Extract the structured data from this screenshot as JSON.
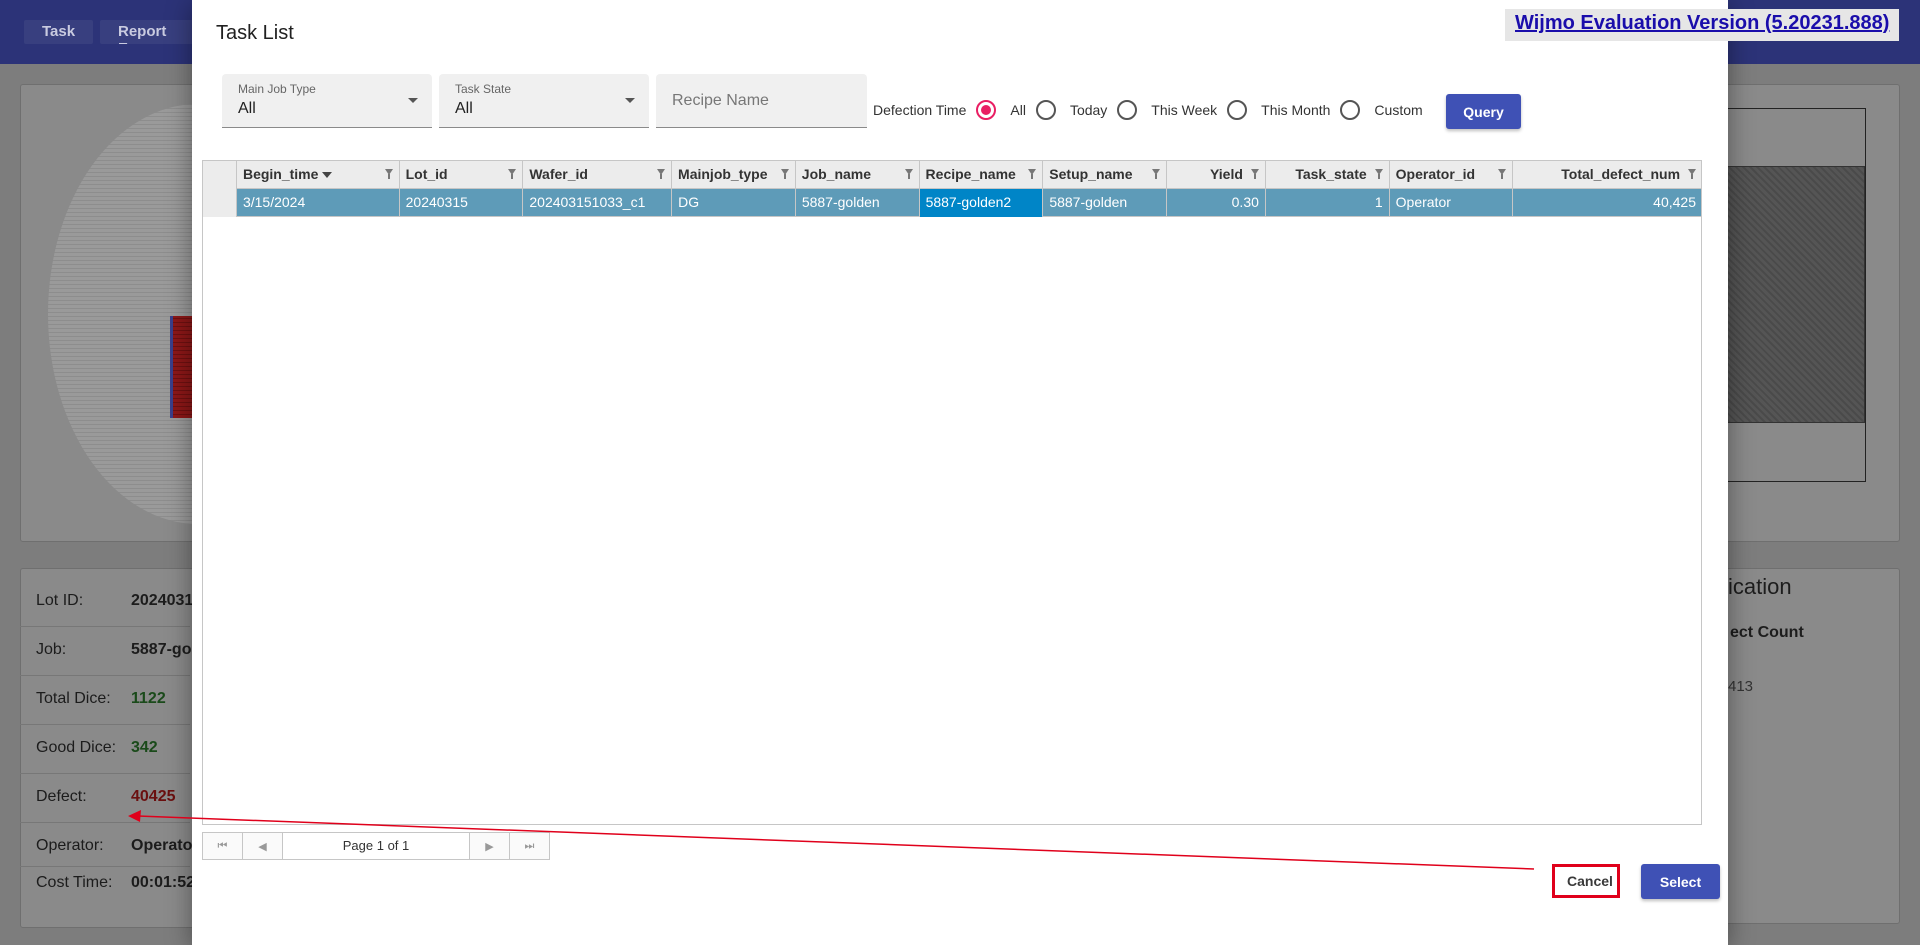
{
  "app": {
    "tabs": [
      {
        "label": "Task"
      },
      {
        "label": "Report Ex"
      }
    ]
  },
  "background_info": {
    "rows": [
      {
        "label": "Lot ID:",
        "value": "2024031"
      },
      {
        "label": "Job:",
        "value": "5887-go"
      },
      {
        "label": "Total Dice:",
        "value": "1122"
      },
      {
        "label": "Good Dice:",
        "value": "342"
      },
      {
        "label": "Defect:",
        "value": "40425"
      },
      {
        "label": "Operator:",
        "value": "Operato"
      },
      {
        "label": "Cost Time:",
        "value": "00:01:52"
      }
    ],
    "right_heading": "ication",
    "right_subheading": "ect Count",
    "right_value": "413"
  },
  "watermark": "Wijmo Evaluation Version (5.20231.888)",
  "dialog": {
    "title": "Task List",
    "filters": {
      "main_job_type": {
        "label": "Main Job Type",
        "value": "All"
      },
      "task_state": {
        "label": "Task State",
        "value": "All"
      },
      "recipe_name": {
        "placeholder": "Recipe Name",
        "value": ""
      },
      "defection_time": {
        "label": "Defection Time",
        "options": [
          {
            "label": "All",
            "checked": true
          },
          {
            "label": "Today",
            "checked": false
          },
          {
            "label": "This Week",
            "checked": false
          },
          {
            "label": "This Month",
            "checked": false
          },
          {
            "label": "Custom",
            "checked": false
          }
        ]
      },
      "query_label": "Query"
    },
    "grid": {
      "columns": [
        {
          "key": "Begin_time",
          "label": "Begin_time",
          "sorted": "desc"
        },
        {
          "key": "Lot_id",
          "label": "Lot_id"
        },
        {
          "key": "Wafer_id",
          "label": "Wafer_id"
        },
        {
          "key": "Mainjob_type",
          "label": "Mainjob_type"
        },
        {
          "key": "Job_name",
          "label": "Job_name"
        },
        {
          "key": "Recipe_name",
          "label": "Recipe_name"
        },
        {
          "key": "Setup_name",
          "label": "Setup_name"
        },
        {
          "key": "Yield",
          "label": "Yield"
        },
        {
          "key": "Task_state",
          "label": "Task_state"
        },
        {
          "key": "Operator_id",
          "label": "Operator_id"
        },
        {
          "key": "Total_defect_num",
          "label": "Total_defect_num"
        }
      ],
      "rows": [
        [
          "3/15/2024",
          "20240315",
          "202403151033_c1",
          "DG",
          "5887-golden",
          "5887-golden2",
          "5887-golden",
          "0.30",
          "1",
          "Operator",
          "40,425"
        ]
      ]
    },
    "pager": {
      "text": "Page 1 of 1"
    },
    "cancel_label": "Cancel",
    "select_label": "Select"
  },
  "colors": {
    "primary": "#3f51b5",
    "radio_accent": "#e91e63",
    "selected_row": "#5e9bb8",
    "selected_cell": "#0085c7",
    "highlight": "#e0001b"
  }
}
